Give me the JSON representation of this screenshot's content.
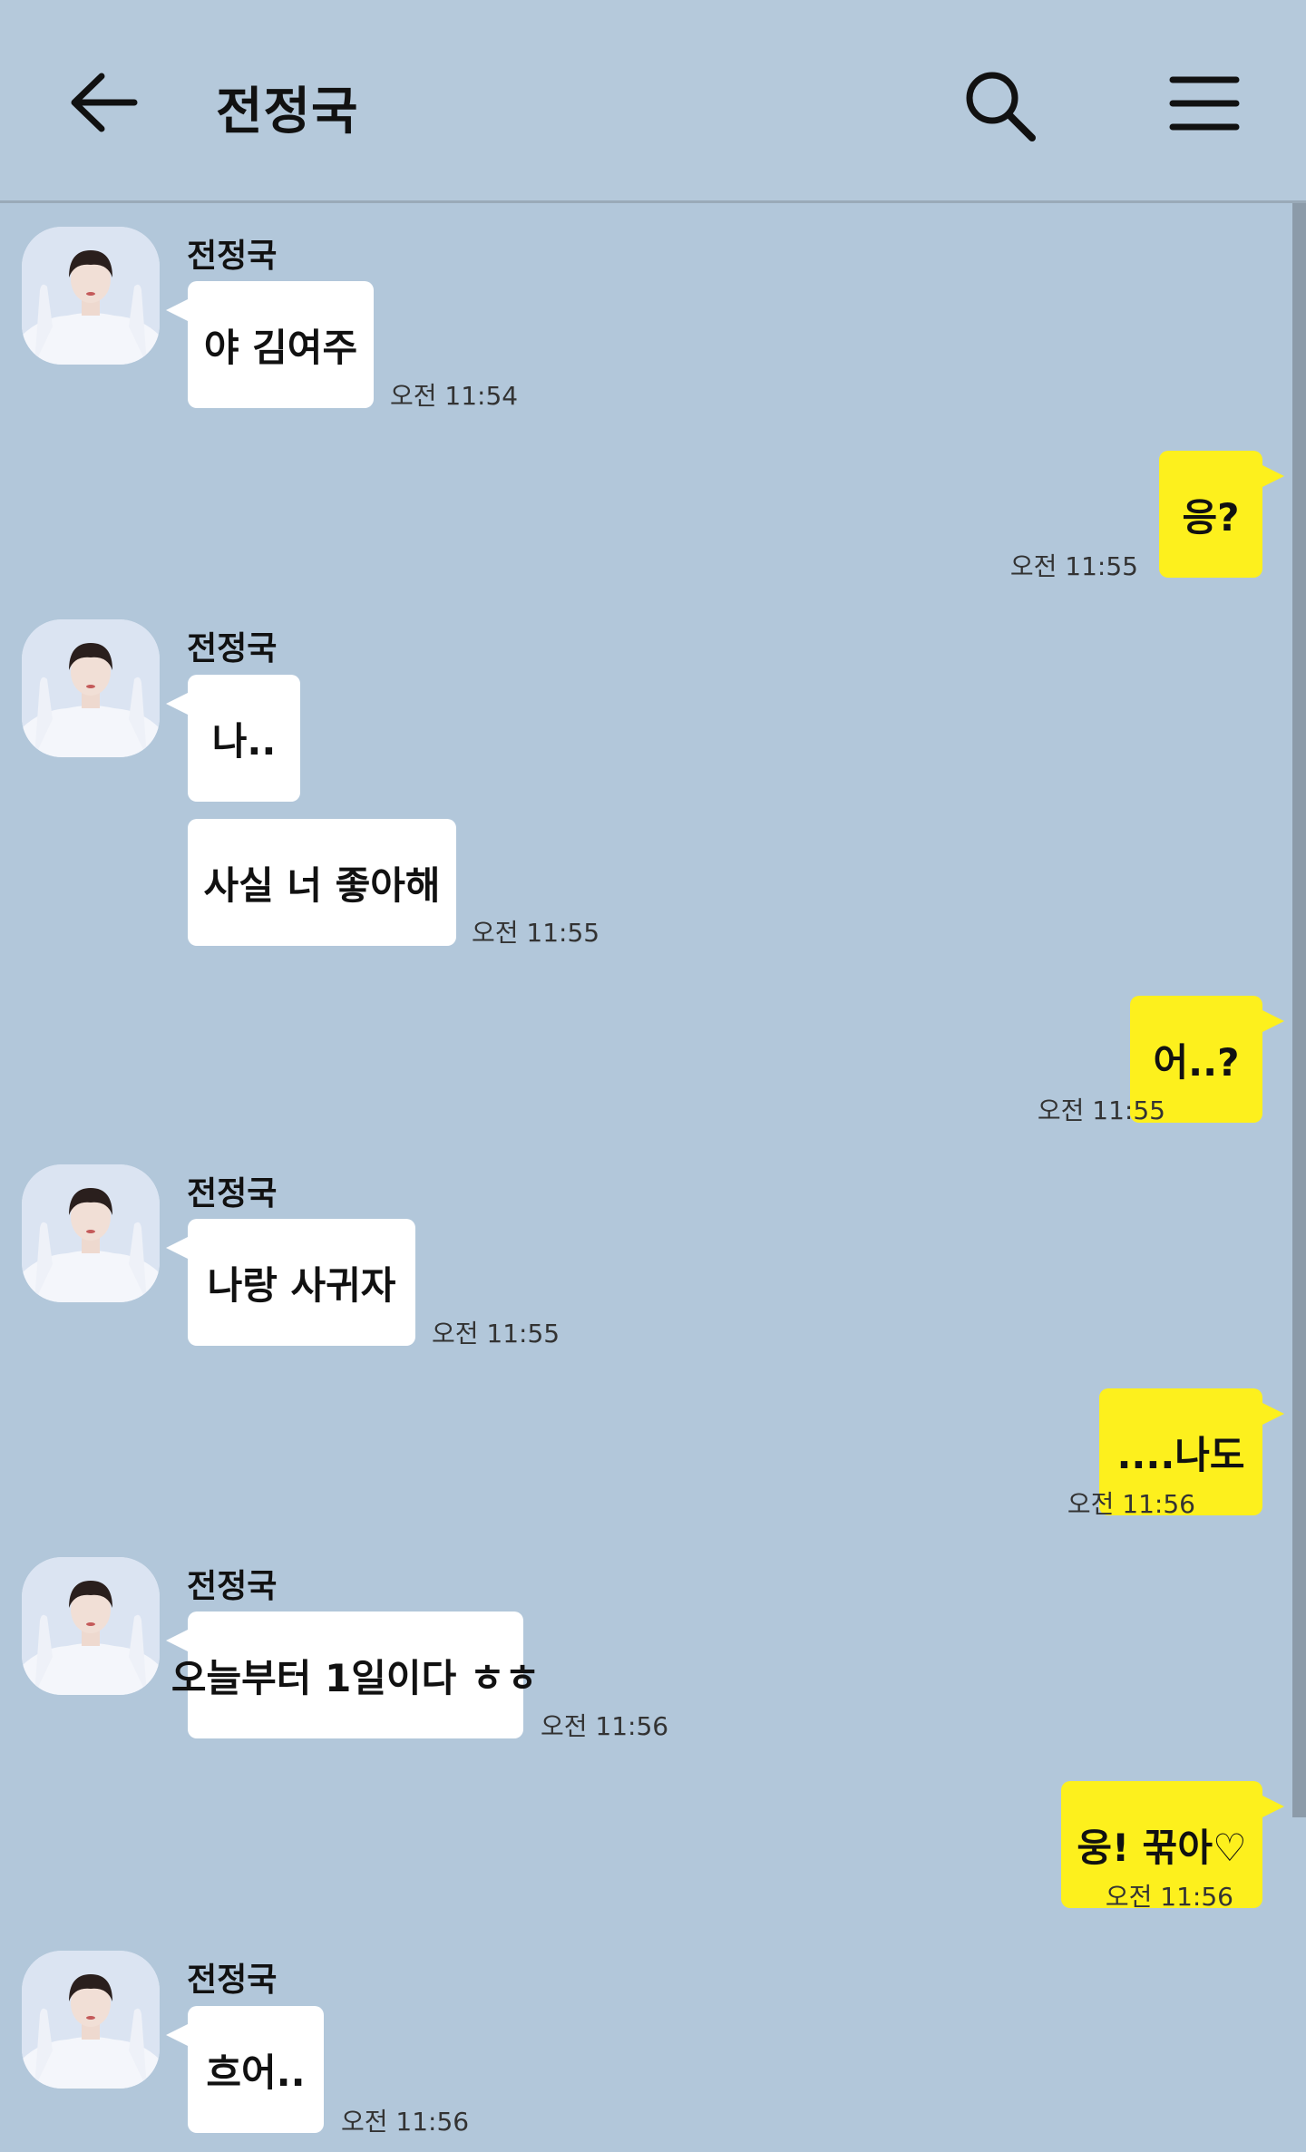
{
  "header": {
    "title": "전정국",
    "back_icon": "arrow-left-icon",
    "search_icon": "search-icon",
    "menu_icon": "hamburger-menu-icon"
  },
  "colors": {
    "background": "#b2c7da",
    "sent_bubble": "#fdf01d",
    "received_bubble": "#ffffff"
  },
  "messages": [
    {
      "sender": "전정국",
      "text": "야 김여주",
      "time": "오전 11:54"
    },
    {
      "text": "응?",
      "time": "오전 11:55"
    },
    {
      "sender": "전정국",
      "text": "나..",
      "time": ""
    },
    {
      "text": "사실 너 좋아해",
      "time": "오전 11:55"
    },
    {
      "text": "어..?",
      "time": "오전 11:55"
    },
    {
      "sender": "전정국",
      "text": "나랑 사귀자",
      "time": "오전 11:55"
    },
    {
      "text": "....나도",
      "time": "오전 11:56"
    },
    {
      "sender": "전정국",
      "text": "오늘부터 1일이다 ㅎㅎ",
      "time": "오전 11:56"
    },
    {
      "text": "웅! 꾺아♡",
      "time": "오전 11:56"
    },
    {
      "sender": "전정국",
      "text": "흐어..",
      "time": "오전 11:56"
    }
  ]
}
